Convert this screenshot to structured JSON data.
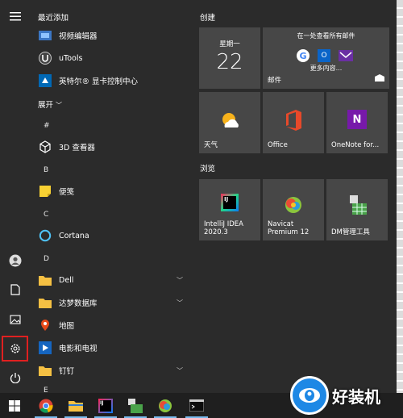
{
  "applist": {
    "recent_header": "最近添加",
    "recent": [
      {
        "label": "视频编辑器"
      },
      {
        "label": "uTools"
      },
      {
        "label": "英特尔® 显卡控制中心"
      }
    ],
    "expand_label": "展开",
    "letters": [
      "#",
      "B",
      "C",
      "D",
      "E"
    ],
    "apps": [
      {
        "label": "3D 查看器"
      },
      {
        "label": "便笺"
      },
      {
        "label": "Cortana"
      },
      {
        "label": "Dell"
      },
      {
        "label": "达梦数据库"
      },
      {
        "label": "地图"
      },
      {
        "label": "电影和电视"
      },
      {
        "label": "钉钉"
      }
    ]
  },
  "tiles": {
    "group1": "创建",
    "calendar": {
      "weekday": "星期一",
      "day": "22"
    },
    "mail": {
      "heading": "在一处查看所有邮件",
      "more": "更多内容...",
      "label": "邮件"
    },
    "weather": "天气",
    "office": "Office",
    "onenote": "OneNote for...",
    "group2": "浏览",
    "idea": "IntelliJ IDEA\n2020.3",
    "navicat": "Navicat\nPremium 12",
    "dm": "DM管理工具"
  },
  "watermark": "好装机"
}
